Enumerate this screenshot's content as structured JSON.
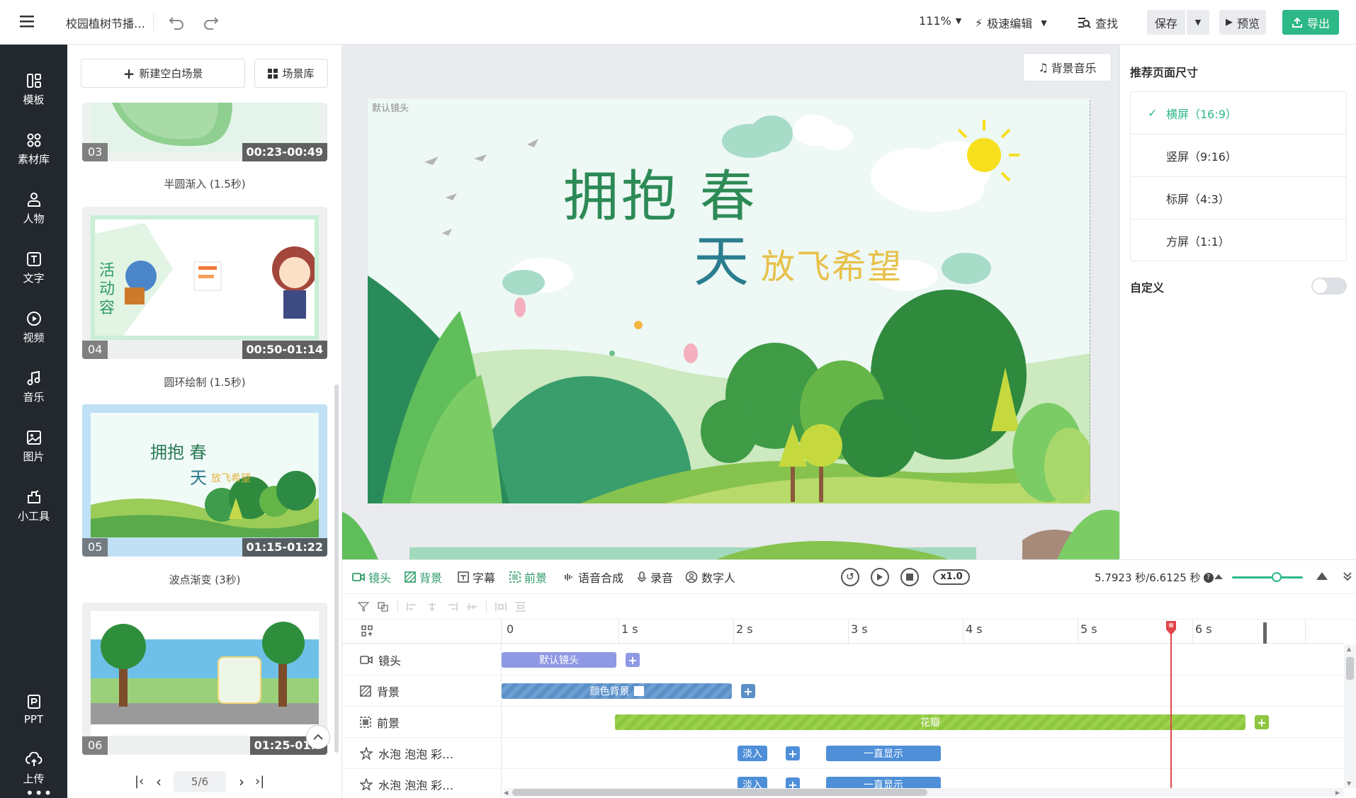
{
  "topbar": {
    "project_title": "校园植树节播…",
    "zoom": "111%",
    "edit_mode": "极速编辑",
    "find": "查找",
    "save": "保存",
    "preview": "预览",
    "export": "导出"
  },
  "leftnav": {
    "items": [
      {
        "label": "模板",
        "icon": "template-icon"
      },
      {
        "label": "素材库",
        "icon": "assets-icon"
      },
      {
        "label": "人物",
        "icon": "person-icon"
      },
      {
        "label": "文字",
        "icon": "text-icon"
      },
      {
        "label": "视频",
        "icon": "video-icon"
      },
      {
        "label": "音乐",
        "icon": "music-icon"
      },
      {
        "label": "图片",
        "icon": "image-icon"
      },
      {
        "label": "小工具",
        "icon": "tools-icon"
      }
    ],
    "bottom": [
      {
        "label": "PPT",
        "icon": "ppt-icon"
      },
      {
        "label": "上传",
        "icon": "upload-icon"
      }
    ]
  },
  "scenepanel": {
    "new_blank": "新建空白场景",
    "library": "场景库",
    "scenes": [
      {
        "num": "03",
        "time": "00:23-00:49",
        "caption": "半圆渐入 (1.5秒)"
      },
      {
        "num": "04",
        "time": "00:50-01:14",
        "caption": "圆环绘制 (1.5秒)"
      },
      {
        "num": "05",
        "time": "01:15-01:22",
        "caption": "波点渐变 (3秒)"
      },
      {
        "num": "06",
        "time": "01:25-01:3"
      }
    ],
    "thumb_texts": {
      "s04_side": "活\n动\n容",
      "s05_title1": "拥抱 春",
      "s05_title2": "天",
      "s05_sub": "放飞希望"
    },
    "pager": "5/6"
  },
  "canvas": {
    "bg_music": "背景音乐",
    "camera_label": "默认镜头",
    "title_line1": "拥抱 春",
    "title_line2": "天",
    "subtitle": "放飞希望"
  },
  "rightpanel": {
    "heading": "推荐页面尺寸",
    "sizes": [
      "横屏（16:9）",
      "竖屏（9:16）",
      "标屏（4:3）",
      "方屏（1:1）"
    ],
    "selected_index": 0,
    "custom": "自定义",
    "custom_on": false
  },
  "timeline": {
    "tabs": [
      {
        "label": "镜头",
        "icon": "camera-icon",
        "green": true
      },
      {
        "label": "背景",
        "icon": "background-icon",
        "green": true
      },
      {
        "label": "字幕",
        "icon": "subtitle-icon",
        "green": false
      },
      {
        "label": "前景",
        "icon": "foreground-icon",
        "green": true
      },
      {
        "label": "语音合成",
        "icon": "tts-icon",
        "green": false
      },
      {
        "label": "录音",
        "icon": "mic-icon",
        "green": false
      },
      {
        "label": "数字人",
        "icon": "avatar-icon",
        "green": false
      }
    ],
    "speed": "x1.0",
    "time_display": "5.7923 秒/6.6125 秒",
    "ticks": [
      "0",
      "1 s",
      "2 s",
      "3 s",
      "4 s",
      "5 s",
      "6 s"
    ],
    "tracks": [
      {
        "label": "镜头",
        "icon": "camera-icon"
      },
      {
        "label": "背景",
        "icon": "background-icon"
      },
      {
        "label": "前景",
        "icon": "foreground-icon"
      },
      {
        "label": "水泡 泡泡 彩…",
        "icon": "star-icon"
      },
      {
        "label": "水泡 泡泡 彩…",
        "icon": "star-icon"
      }
    ],
    "clips": {
      "camera": "默认镜头",
      "background": "颜色背景",
      "foreground": "花瓣",
      "fade_in": "淡入",
      "always_show": "一直显示"
    },
    "playhead_seconds": 5.7923,
    "total_seconds": 6.6125
  },
  "colors": {
    "accent_green": "#2db987",
    "nav_bg": "#23272e",
    "camera_clip": "#8f98e3",
    "background_clip": "#5b8fc6",
    "foreground_clip": "#8dc63f",
    "effect_clip": "#4e8fd8",
    "playhead": "#e2454a"
  }
}
